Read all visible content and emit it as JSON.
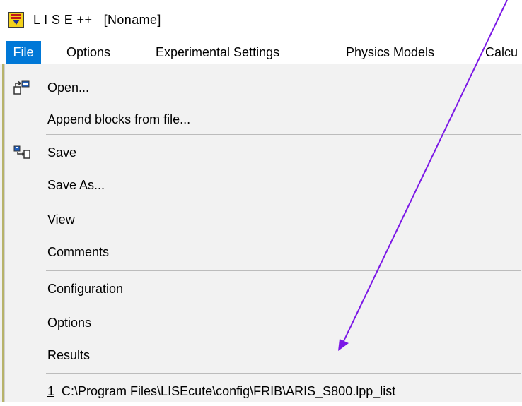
{
  "window": {
    "title": "L I S E ++   [Noname]",
    "icon": "lise-app-icon"
  },
  "menubar": {
    "items": [
      "File",
      "Options",
      "Experimental Settings",
      "Physics Models",
      "Calcu"
    ],
    "active": "File"
  },
  "file_menu": {
    "open": "Open...",
    "append": "Append blocks from file...",
    "save": "Save",
    "save_as": "Save As...",
    "view": "View",
    "comments": "Comments",
    "configuration": "Configuration",
    "options": "Options",
    "results": "Results",
    "recent_number": "1",
    "recent_path": "C:\\Program Files\\LISEcute\\config\\FRIB\\ARIS_S800.lpp_list"
  },
  "colors": {
    "menu_highlight": "#0078d7",
    "menu_background": "#f2f2f2",
    "arrow": "#7b17e6",
    "app_icon_yellow": "#f3d21b",
    "app_icon_red": "#c0161b",
    "app_icon_blue": "#1c2b8f"
  }
}
